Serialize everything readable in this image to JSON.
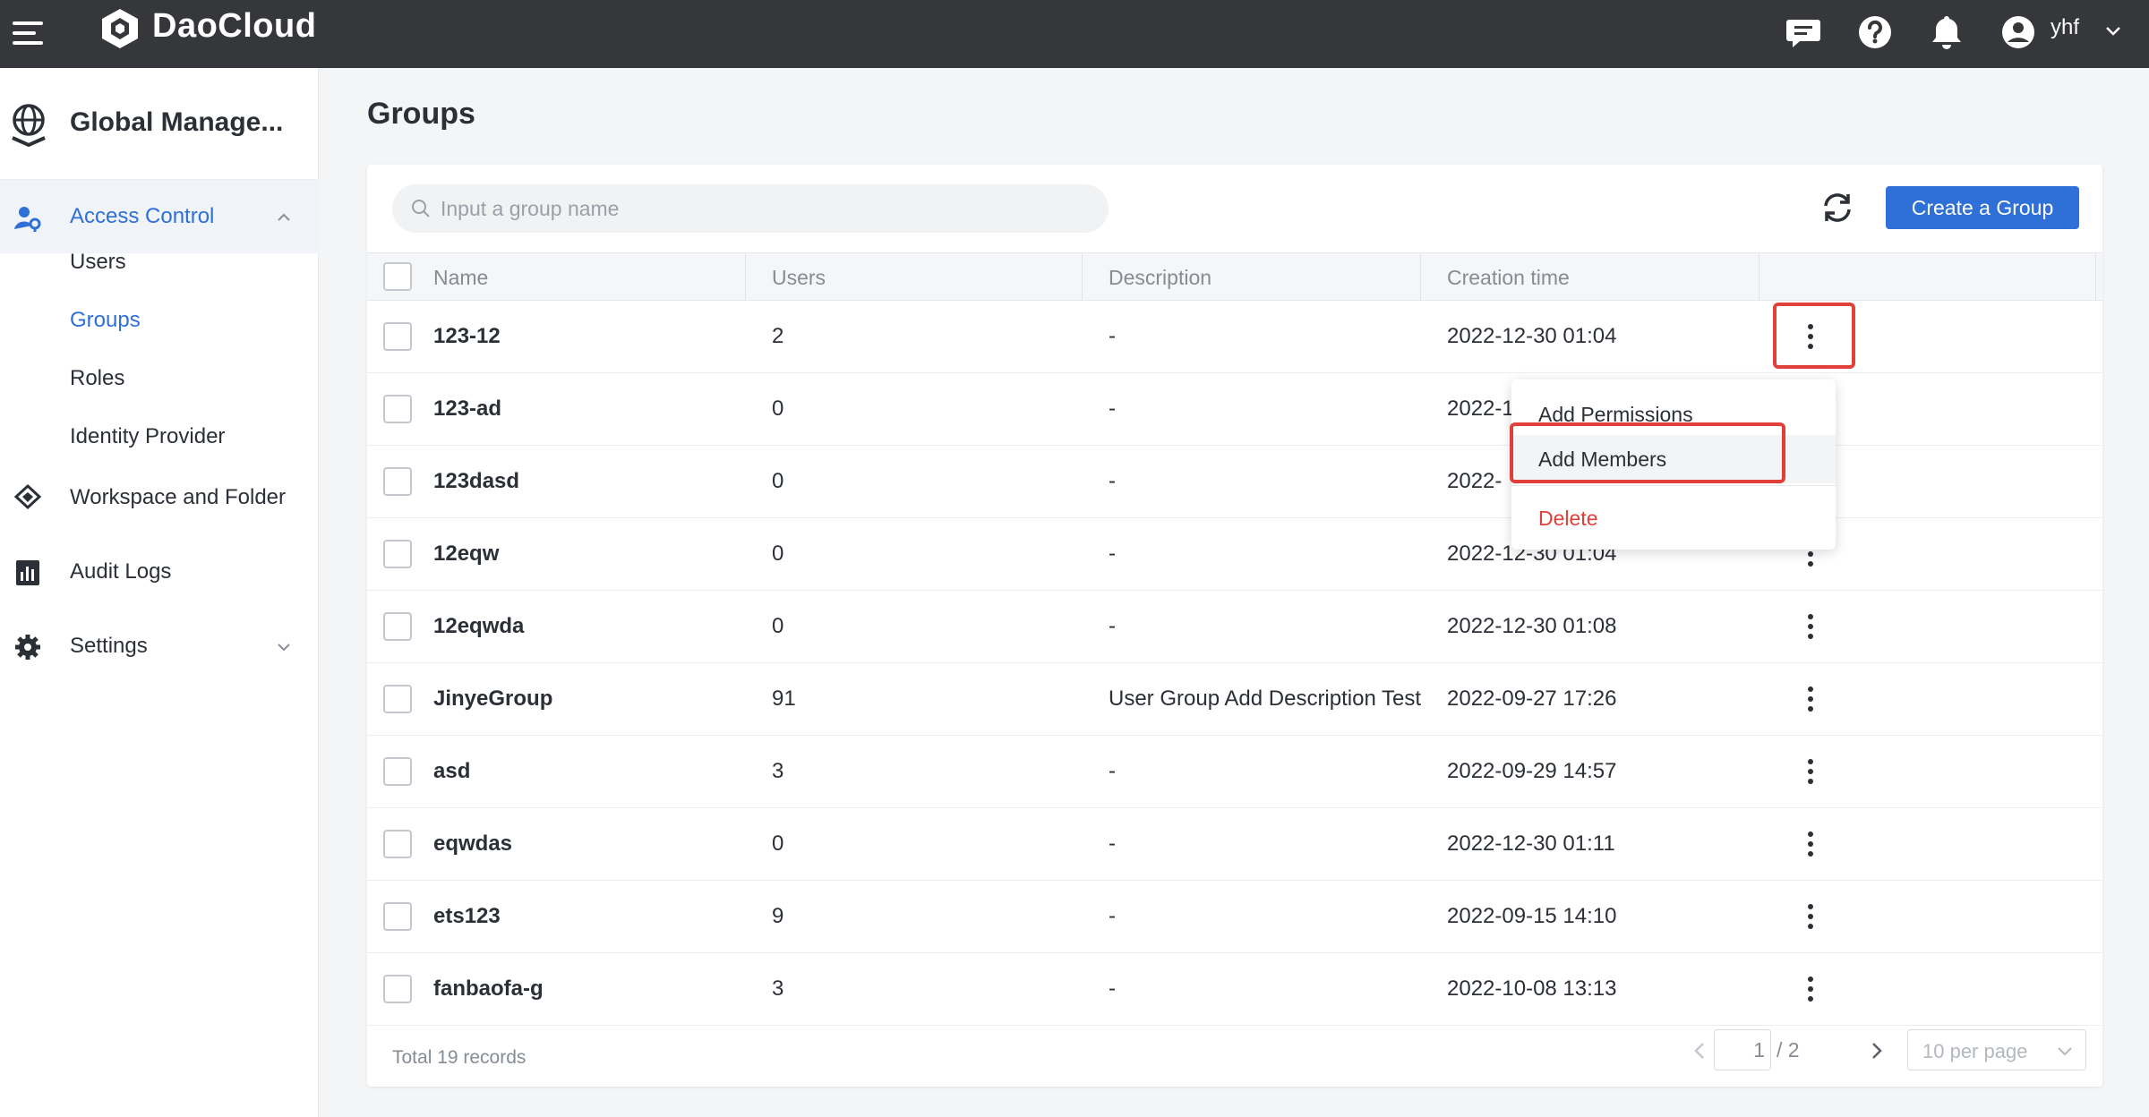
{
  "brand": {
    "name": "DaoCloud"
  },
  "topbar": {
    "username": "yhf",
    "icons": [
      "hamburger-icon",
      "message-icon",
      "help-icon",
      "bell-icon",
      "user-avatar-icon",
      "chevron-down-icon"
    ]
  },
  "sidebar": {
    "module_title": "Global Manage...",
    "access_control": "Access Control",
    "sub_items": [
      "Users",
      "Groups",
      "Roles",
      "Identity Provider"
    ],
    "active_sub": "Groups",
    "workspace": "Workspace and Folder",
    "audit": "Audit Logs",
    "settings": "Settings"
  },
  "page": {
    "title": "Groups"
  },
  "search": {
    "placeholder": "Input a group name",
    "value": ""
  },
  "toolbar": {
    "create_label": "Create a Group"
  },
  "table": {
    "columns": [
      "Name",
      "Users",
      "Description",
      "Creation time"
    ],
    "rows": [
      {
        "name": "123-12",
        "users": "2",
        "description": "-",
        "created": "2022-12-30 01:04"
      },
      {
        "name": "123-ad",
        "users": "0",
        "description": "-",
        "created": "2022-1"
      },
      {
        "name": "123dasd",
        "users": "0",
        "description": "-",
        "created": "2022-"
      },
      {
        "name": "12eqw",
        "users": "0",
        "description": "-",
        "created": "2022-12-30 01:04"
      },
      {
        "name": "12eqwda",
        "users": "0",
        "description": "-",
        "created": "2022-12-30 01:08"
      },
      {
        "name": "JinyeGroup",
        "users": "91",
        "description": "User Group Add Description Test",
        "created": "2022-09-27 17:26"
      },
      {
        "name": "asd",
        "users": "3",
        "description": "-",
        "created": "2022-09-29 14:57"
      },
      {
        "name": "eqwdas",
        "users": "0",
        "description": "-",
        "created": "2022-12-30 01:11"
      },
      {
        "name": "ets123",
        "users": "9",
        "description": "-",
        "created": "2022-09-15 14:10"
      },
      {
        "name": "fanbaofa-g",
        "users": "3",
        "description": "-",
        "created": "2022-10-08 13:13"
      }
    ]
  },
  "context_menu": {
    "items": [
      "Add Permissions",
      "Add Members",
      "Delete"
    ],
    "highlighted": "Add Members"
  },
  "pagination": {
    "total": "Total 19 records",
    "current": "1",
    "pages": "/ 2",
    "per_page": "10 per page"
  },
  "colors": {
    "topbar": "#35373b",
    "primary": "#2e6fd8",
    "danger": "#e0403a",
    "highlight_box": "#e0403a"
  }
}
